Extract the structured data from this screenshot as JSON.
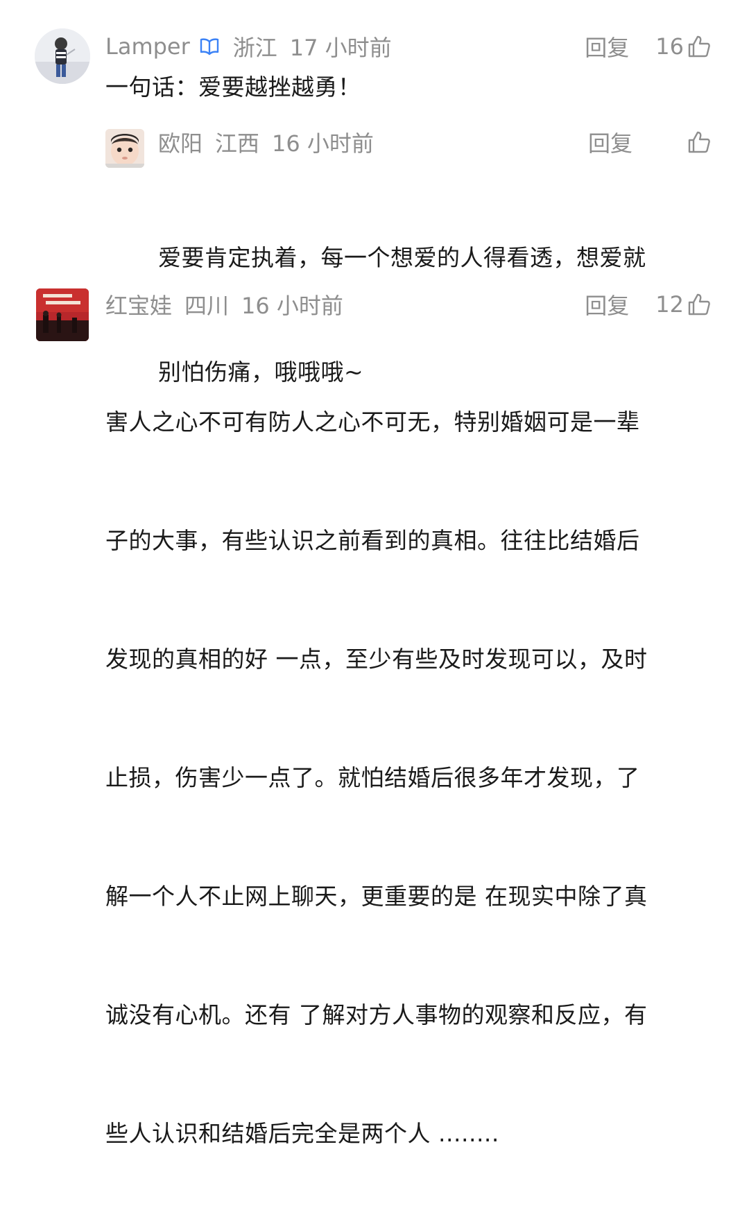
{
  "comments": [
    {
      "user": "Lamper",
      "verified_icon": "verified-badge-icon",
      "region": "浙江",
      "time": "17 小时前",
      "reply_label": "回复",
      "likes": "16",
      "text": "一句话：爱要越挫越勇！",
      "replies": [
        {
          "user": "欧阳",
          "region": "江西",
          "time": "16 小时前",
          "reply_label": "回复",
          "likes": "",
          "text_lines": [
            "爱要肯定执着，每一个想爱的人得看透，想爱就",
            "别怕伤痛，哦哦哦~"
          ]
        }
      ]
    },
    {
      "user": "红宝娃",
      "region": "四川",
      "time": "16 小时前",
      "reply_label": "回复",
      "likes": "12",
      "text_lines": [
        "害人之心不可有防人之心不可无，特别婚姻可是一辈",
        "子的大事，有些认识之前看到的真相。往往比结婚后",
        "发现的真相的好 一点，至少有些及时发现可以，及时",
        "止损，伤害少一点了。就怕结婚后很多年才发现，了",
        "解一个人不止网上聊天，更重要的是 在现实中除了真",
        "诚没有心机。还有 了解对方人事物的观察和反应，有",
        "些人认识和结婚后完全是两个人 ........"
      ]
    }
  ],
  "colors": {
    "meta_gray": "#8e8e8e",
    "text_dark": "#1a1a1a",
    "verified_blue": "#3b82f6"
  }
}
